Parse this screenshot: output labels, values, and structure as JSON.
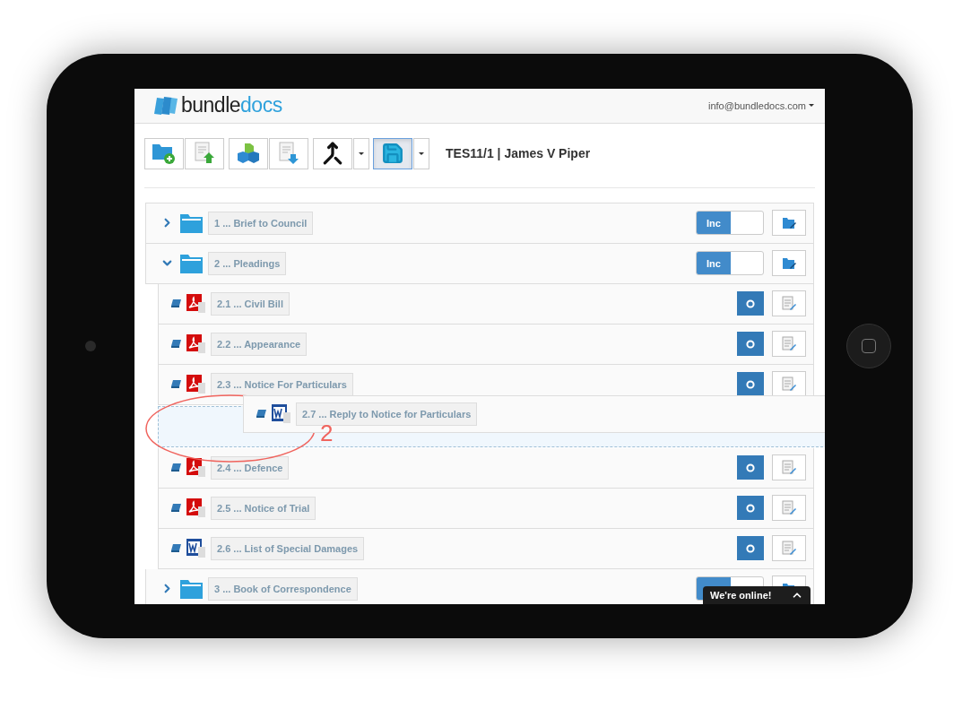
{
  "header": {
    "logo_words": [
      "bundle",
      "docs"
    ],
    "account": "info@bundledocs.com"
  },
  "toolbar": [
    {
      "kind": "add-folder",
      "selected": false,
      "has_menu": false
    },
    {
      "kind": "upload",
      "selected": false,
      "has_menu": false
    },
    {
      "kind": "package",
      "selected": false,
      "has_menu": false
    },
    {
      "kind": "download",
      "selected": false,
      "has_menu": false
    },
    {
      "kind": "merge",
      "selected": false,
      "has_menu": true
    },
    {
      "kind": "save",
      "selected": true,
      "has_menu": true
    }
  ],
  "bundle_title": "TES11/1 | James V Piper",
  "items": [
    {
      "kind": "folder",
      "label": "1 ... Brief to Council",
      "expanded": false,
      "included": true,
      "toggle_label": "Inc"
    },
    {
      "kind": "folder",
      "label": "2 ... Pleadings",
      "expanded": true,
      "included": true,
      "toggle_label": "Inc",
      "children": [
        {
          "kind": "pdf",
          "label": "2.1 ... Civil Bill"
        },
        {
          "kind": "pdf",
          "label": "2.2 ... Appearance"
        },
        {
          "kind": "pdf",
          "label": "2.3 ... Notice For Particulars"
        },
        {
          "kind": "drop-target",
          "dragged": {
            "kind": "word",
            "label": "2.7 ... Reply to Notice for Particulars"
          },
          "annotation": "2"
        },
        {
          "kind": "pdf",
          "label": "2.4 ... Defence"
        },
        {
          "kind": "pdf",
          "label": "2.5 ... Notice of Trial"
        },
        {
          "kind": "word",
          "label": "2.6 ... List of Special Damages"
        }
      ]
    },
    {
      "kind": "folder",
      "label": "3 ... Book of Correspondence",
      "expanded": false,
      "included": true
    }
  ],
  "chat": {
    "label": "We're online!"
  }
}
